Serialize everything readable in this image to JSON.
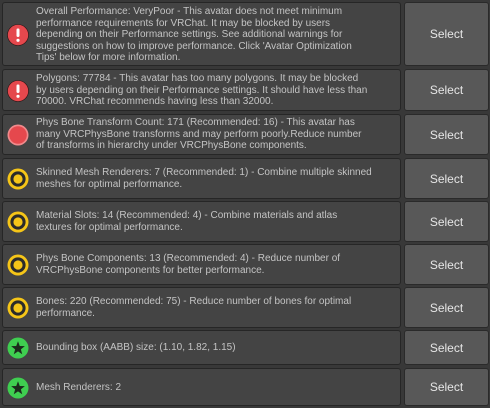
{
  "select_label": "Select",
  "colors": {
    "error": "#e5484d",
    "warning": "#f5c518",
    "ok": "#3fce50"
  },
  "items": [
    {
      "severity": "error",
      "icon": "error-exclamation-icon",
      "text": "Overall Performance: VeryPoor - This avatar does not meet minimum\nperformance requirements for VRChat. It may be blocked by users\ndepending on their Performance settings. See additional warnings for\nsuggestions on how to improve performance. Click 'Avatar Optimization\nTips' below for more information."
    },
    {
      "severity": "error",
      "icon": "error-exclamation-icon",
      "text": "Polygons: 77784 - This avatar has too many polygons. It may be blocked\nby users depending on their Performance settings. It should have less than\n70000. VRChat recommends having less than 32000."
    },
    {
      "severity": "error",
      "icon": "error-circle-icon",
      "text": "Phys Bone Transform Count: 171 (Recommended: 16) - This avatar has\nmany VRCPhysBone transforms and may perform poorly.Reduce number\nof transforms in hierarchy under VRCPhysBone components."
    },
    {
      "severity": "warning",
      "icon": "warning-circle-icon",
      "text": "Skinned Mesh Renderers: 7 (Recommended: 1) - Combine multiple skinned\nmeshes for optimal performance."
    },
    {
      "severity": "warning",
      "icon": "warning-circle-icon",
      "text": "Material Slots: 14 (Recommended: 4) - Combine materials and atlas\ntextures for optimal performance."
    },
    {
      "severity": "warning",
      "icon": "warning-circle-icon",
      "text": "Phys Bone Components: 13 (Recommended: 4) - Reduce number of\nVRCPhysBone components for better performance."
    },
    {
      "severity": "warning",
      "icon": "warning-circle-icon",
      "text": "Bones: 220 (Recommended: 75) - Reduce number of bones for optimal\nperformance."
    },
    {
      "severity": "ok",
      "icon": "star-icon",
      "text": "Bounding box (AABB) size: (1.10, 1.82, 1.15)"
    },
    {
      "severity": "ok",
      "icon": "star-icon",
      "text": "Mesh Renderers: 2"
    }
  ]
}
